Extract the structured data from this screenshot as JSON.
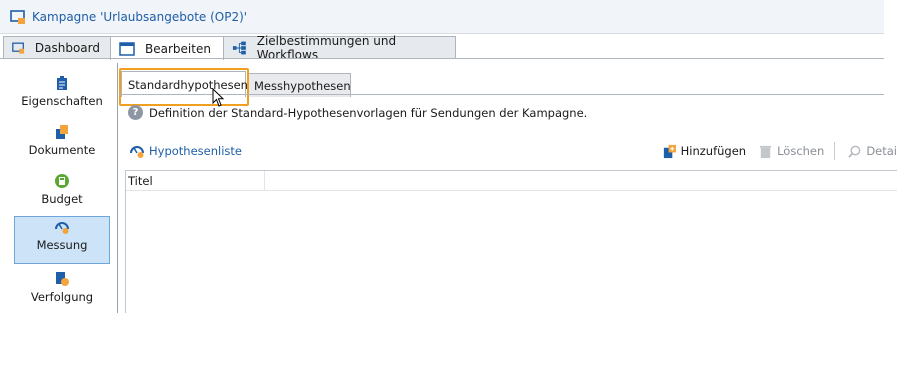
{
  "window": {
    "title": "Kampagne 'Urlaubsangebote (OP2)'"
  },
  "main_tabs": [
    {
      "label": "Dashboard",
      "icon": "dashboard-icon",
      "active": false
    },
    {
      "label": "Bearbeiten",
      "icon": "edit-window-icon",
      "active": true
    },
    {
      "label": "Zielbestimmungen und Workflows",
      "icon": "workflow-icon",
      "active": false
    }
  ],
  "sidebar": {
    "items": [
      {
        "label": "Eigenschaften",
        "icon": "clipboard-icon",
        "active": false
      },
      {
        "label": "Dokumente",
        "icon": "documents-icon",
        "active": false
      },
      {
        "label": "Budget",
        "icon": "calculator-icon",
        "active": false
      },
      {
        "label": "Messung",
        "icon": "gauge-icon",
        "active": true
      },
      {
        "label": "Verfolgung",
        "icon": "tracking-icon",
        "active": false
      }
    ]
  },
  "sub_tabs": [
    {
      "label": "Standardhypothesen",
      "active": true
    },
    {
      "label": "Messhypothesen",
      "active": false
    }
  ],
  "info_text": "Definition der Standard-Hypothesenvorlagen für Sendungen der Kampagne.",
  "toolbar": {
    "list_label": "Hypothesenliste",
    "add_label": "Hinzufügen",
    "delete_label": "Löschen",
    "details_label": "Detai"
  },
  "grid": {
    "columns": [
      "Titel"
    ]
  },
  "colors": {
    "accent": "#1f5ea8",
    "highlight": "#f0a020",
    "active_bg": "#cde3f7"
  }
}
